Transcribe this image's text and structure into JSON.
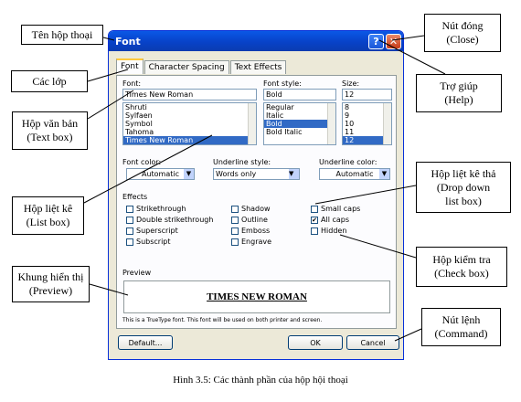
{
  "dialog": {
    "title": "Font",
    "help": "?",
    "close": "✕"
  },
  "tabs": [
    "Font",
    "Character Spacing",
    "Text Effects"
  ],
  "font": {
    "label": "Font:",
    "value": "Times New Roman",
    "items": [
      "Shruti",
      "Sylfaen",
      "Symbol",
      "Tahoma",
      "Times New Roman"
    ]
  },
  "style": {
    "label": "Font style:",
    "value": "Bold",
    "items": [
      "Regular",
      "Italic",
      "Bold",
      "Bold Italic"
    ]
  },
  "size": {
    "label": "Size:",
    "value": "12",
    "items": [
      "8",
      "9",
      "10",
      "11",
      "12"
    ]
  },
  "color": {
    "label": "Font color:",
    "value": "Automatic"
  },
  "underline": {
    "label": "Underline style:",
    "value": "Words only"
  },
  "ucolor": {
    "label": "Underline color:",
    "value": "Automatic"
  },
  "effects": {
    "label": "Effects",
    "items": [
      "Strikethrough",
      "Double strikethrough",
      "Superscript",
      "Subscript",
      "Shadow",
      "Outline",
      "Emboss",
      "Engrave",
      "Small caps",
      "All caps",
      "Hidden"
    ],
    "checked": "✔"
  },
  "preview": {
    "label": "Preview",
    "text": "TIMES NEW ROMAN",
    "note": "This is a TrueType font. This font will be used on both printer and screen."
  },
  "buttons": {
    "default": "Default...",
    "ok": "OK",
    "cancel": "Cancel"
  },
  "callouts": {
    "title": "Tên hộp thoại",
    "tabs": "Các lớp",
    "textbox": "Hộp văn bản\n(Text box)",
    "listbox": "Hộp liệt kê\n(List box)",
    "preview": "Khung hiển thị\n(Preview)",
    "close": "Nút đóng\n(Close)",
    "help": "Trợ giúp\n(Help)",
    "dropdown": "Hộp liệt kê thả\n(Drop down\nlist box)",
    "check": "Hộp kiểm tra\n(Check box)",
    "command": "Nút lệnh\n(Command)"
  },
  "caption": "Hình 3.5: Các thành phần của hộp hội thoại"
}
